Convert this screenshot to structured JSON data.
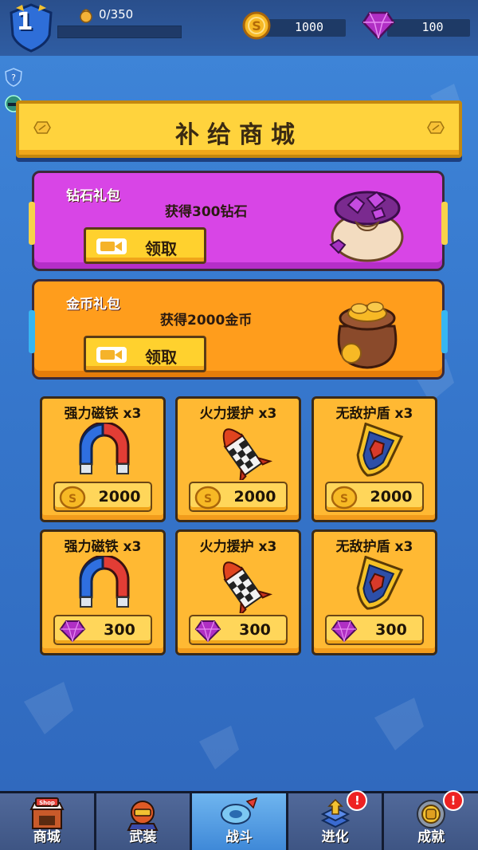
{
  "player": {
    "level": "1",
    "xp_text": "0/350",
    "xp_progress": 0.0
  },
  "currency": {
    "coins": "1000",
    "gems": "100"
  },
  "shop": {
    "title": "补给商城"
  },
  "packs": [
    {
      "name": "钻石礼包",
      "desc": "获得300钻石",
      "button": "领取",
      "icon": "gem-bag-icon"
    },
    {
      "name": "金币礼包",
      "desc": "获得2000金币",
      "button": "领取",
      "icon": "coin-bag-icon"
    }
  ],
  "items_row1": [
    {
      "name": "强力磁铁 x3",
      "price": "2000",
      "currency_icon": "coin-icon",
      "icon": "magnet-icon"
    },
    {
      "name": "火力援护 x3",
      "price": "2000",
      "currency_icon": "coin-icon",
      "icon": "rocket-icon"
    },
    {
      "name": "无敌护盾 x3",
      "price": "2000",
      "currency_icon": "coin-icon",
      "icon": "shield-icon"
    }
  ],
  "items_row2": [
    {
      "name": "强力磁铁 x3",
      "price": "300",
      "currency_icon": "gem-icon",
      "icon": "magnet-icon"
    },
    {
      "name": "火力援护 x3",
      "price": "300",
      "currency_icon": "gem-icon",
      "icon": "rocket-icon"
    },
    {
      "name": "无敌护盾 x3",
      "price": "300",
      "currency_icon": "gem-icon",
      "icon": "shield-icon"
    }
  ],
  "nav": {
    "items": [
      {
        "label": "商城",
        "icon": "shop-icon",
        "active": false,
        "badge": ""
      },
      {
        "label": "武装",
        "icon": "armor-icon",
        "active": false,
        "badge": ""
      },
      {
        "label": "战斗",
        "icon": "battle-icon",
        "active": true,
        "badge": ""
      },
      {
        "label": "进化",
        "icon": "evolve-icon",
        "active": false,
        "badge": "!"
      },
      {
        "label": "成就",
        "icon": "achievement-icon",
        "active": false,
        "badge": "!"
      }
    ]
  },
  "colors": {
    "background": "#3677cc",
    "title_banner": "#ffd33d",
    "diamond_pack": "#d845e6",
    "coin_pack": "#ff9d1c",
    "item_card": "#ffb933"
  }
}
